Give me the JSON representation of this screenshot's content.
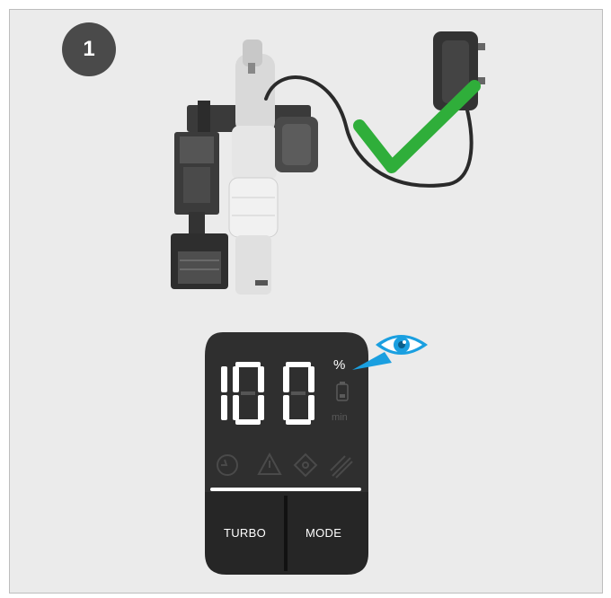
{
  "step": {
    "number": "1"
  },
  "display": {
    "percent_value": 100,
    "percent_digits": "100",
    "percent_unit": "%",
    "time_unit": "min"
  },
  "buttons": {
    "turbo_label": "TURBO",
    "mode_label": "MODE"
  },
  "icons": [
    "vacuum-cleaner-icon",
    "charger-adapter-icon",
    "checkmark-icon",
    "eye-icon",
    "battery-icon",
    "self-clean-icon",
    "warning-icon",
    "filter-icon",
    "brush-icon"
  ],
  "colors": {
    "panel_bg": "#ebebeb",
    "badge_bg": "#4a4a4a",
    "display_bg": "#2d2d2d",
    "check_green": "#2fae3a",
    "eye_blue": "#1a9fe0"
  }
}
